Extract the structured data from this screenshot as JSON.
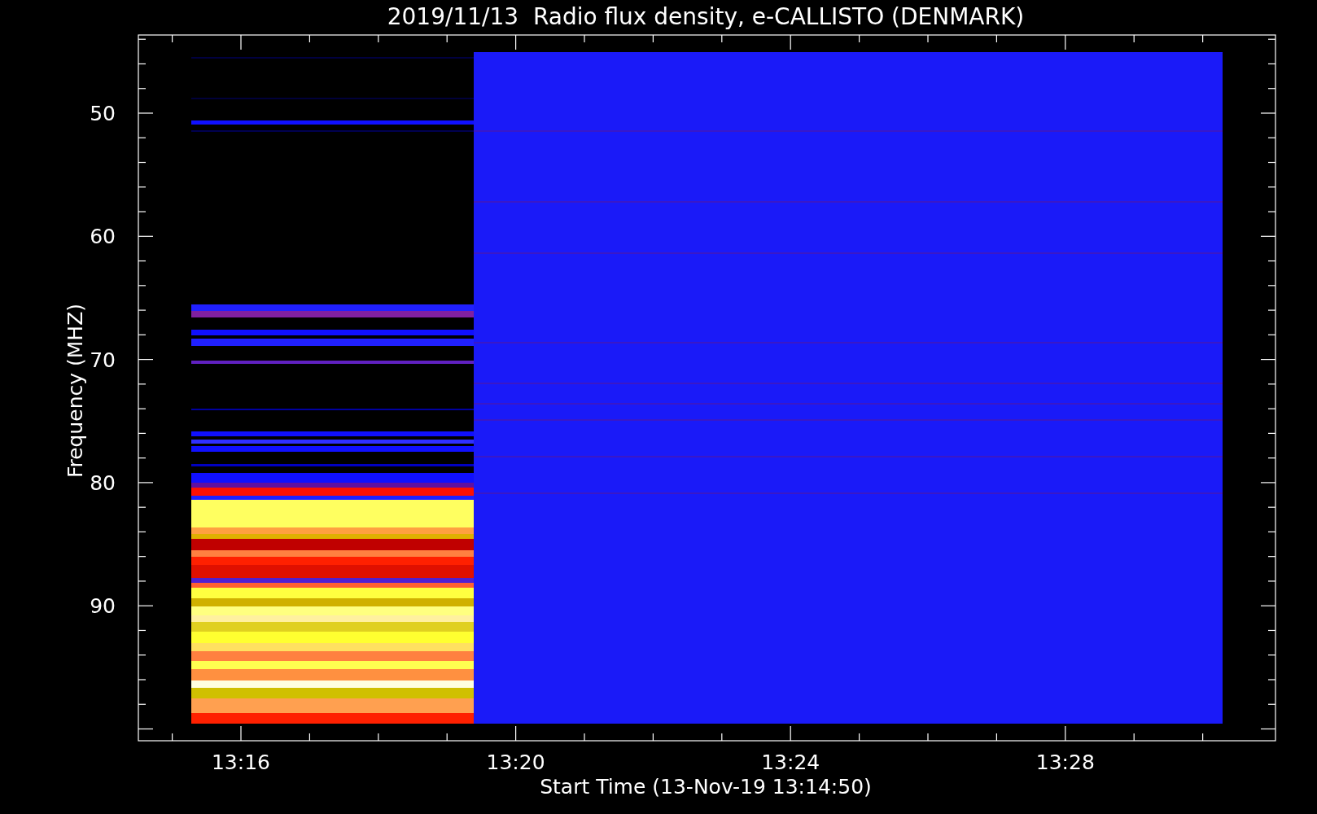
{
  "title": "2019/11/13  Radio flux density, e-CALLISTO (DENMARK)",
  "y_axis": {
    "label": "Frequency (MHZ)",
    "ticks": [
      "50",
      "60",
      "70",
      "80",
      "90"
    ]
  },
  "x_axis": {
    "label": "Start Time (13-Nov-19 13:14:50)",
    "ticks": [
      "13:16",
      "13:20",
      "13:24",
      "13:28"
    ]
  }
}
